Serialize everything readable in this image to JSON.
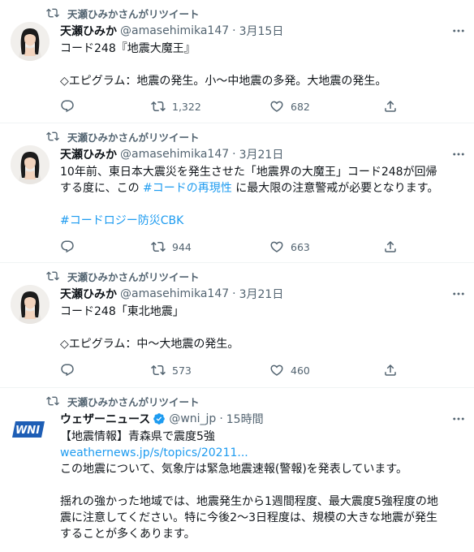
{
  "tweets": [
    {
      "retweet_label": "天瀬ひみかさんがリツイート",
      "name": "天瀬ひみか",
      "handle": "@amasehimika147",
      "dot": "·",
      "time": "3月15日",
      "lines": [
        "コード248『地震大魔王』",
        "",
        "◇エピグラム：地震の発生。小〜中地震の多発。大地震の発生。"
      ],
      "replies": "",
      "retweets": "1,322",
      "likes": "682"
    },
    {
      "retweet_label": "天瀬ひみかさんがリツイート",
      "name": "天瀬ひみか",
      "handle": "@amasehimika147",
      "dot": "·",
      "time": "3月21日",
      "line1": "10年前、東日本大震災を発生させた「地震界の大魔王」コード248が回帰",
      "line2_pre": "する度に、この ",
      "line2_tag": "#コードの再現性",
      "line2_post": " に最大限の注意警戒が必要となります。",
      "hashtag": "#コードロジー防災CBK",
      "replies": "",
      "retweets": "944",
      "likes": "663"
    },
    {
      "name": "天瀬ひみか",
      "handle": "@amasehimika147",
      "dot": "·",
      "time": "3月21日",
      "lines": [
        "コード248「東北地震」",
        "",
        "◇エピグラム：中〜大地震の発生。"
      ],
      "replies": "",
      "retweets": "573",
      "likes": "460"
    },
    {
      "retweet_label": "天瀬ひみかさんがリツイート",
      "name": "ウェザーニュース",
      "handle": "@wni_jp",
      "dot": "·",
      "time": "15時間",
      "avatar_text": "WNI",
      "line1": "【地震情報】青森県で震度5強",
      "link": "weathernews.jp/s/topics/20211...",
      "line3": "この地震について、気象庁は緊急地震速報(警報)を発表しています。",
      "line4": "揺れの強かった地域では、地震発生から1週間程度、最大震度5強程度の地",
      "line5": "震に注意してください。特に今後2〜3日程度は、規模の大きな地震が発生",
      "line6": "することが多くあります。"
    }
  ],
  "colors": {
    "accent": "#1d9bf0",
    "muted": "#536471",
    "text": "#0f1419",
    "wni": "#1e5eb5"
  }
}
